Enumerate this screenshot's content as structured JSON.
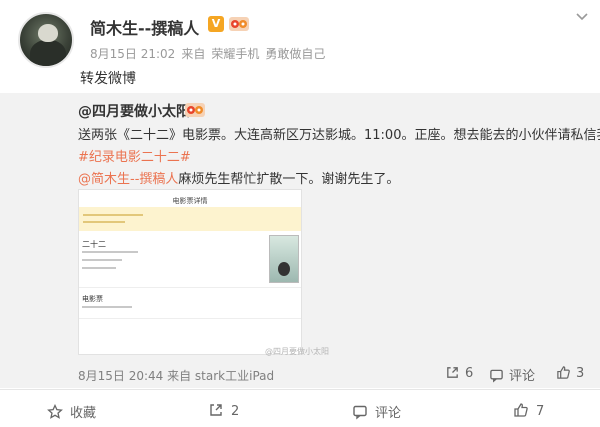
{
  "post": {
    "author_name": "简木生--撰稿人",
    "verified_badge": "V",
    "time": "8月15日 21:02",
    "source_prefix": "来自",
    "source_device": "荣耀手机",
    "source_tail": "勇敢做自己",
    "text": "转发微博"
  },
  "repost": {
    "author": "@四月要做小太阳",
    "text": "送两张《二十二》电影票。大连高新区万达影城。11:00。正座。想去能去的小伙伴请私信我。",
    "hashtag": "#纪录电影二十二#",
    "mention": "@简木生--撰稿人",
    "mention_text": "麻烦先生帮忙扩散一下。谢谢先生了。",
    "image": {
      "title": "电影票详情",
      "movie": "二十二",
      "section": "电影票",
      "poster_text": "二十二"
    },
    "watermark": "@四月要做小太阳",
    "footer": "8月15日 20:44 来自 stark工业iPad",
    "share_count": "6",
    "comment_label": "评论",
    "like_count": "3"
  },
  "actions": {
    "favorite": "收藏",
    "share": "2",
    "comment": "评论",
    "like": "7"
  },
  "colors": {
    "accent": "#eb7350",
    "repost_bg": "#f2f2f2",
    "meta_text": "#999999",
    "badge": "#f5a623"
  }
}
